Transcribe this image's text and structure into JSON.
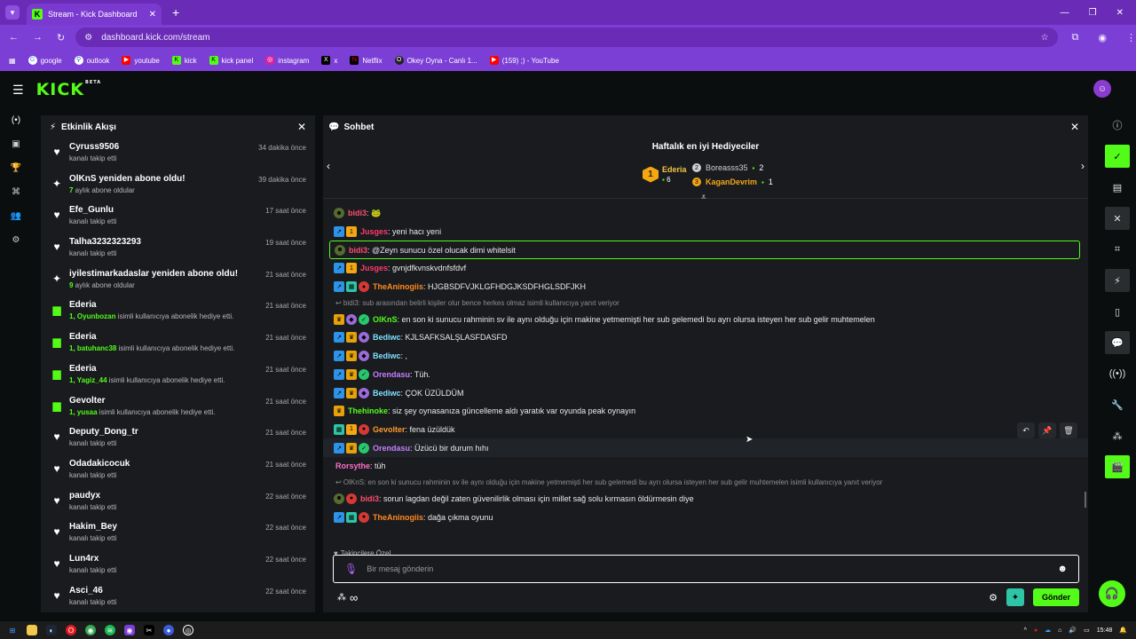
{
  "browser": {
    "tab_title": "Stream - Kick Dashboard",
    "url": "dashboard.kick.com/stream",
    "bookmarks": [
      "google",
      "outlook",
      "youtube",
      "kick",
      "kick panel",
      "instagram",
      "x",
      "Netflix",
      "Okey Oyna - Canlı 1...",
      "(159) ;) - YouTube"
    ]
  },
  "header": {
    "logo": "KICK",
    "beta": "BETA"
  },
  "activity": {
    "title": "Etkinlik Akışı",
    "events": [
      {
        "name": "Cyruss9506",
        "sub": "kanalı takip etti",
        "time": "34 dakika önce",
        "icon": "heart"
      },
      {
        "name": "OlKnS yeniden abone oldu!",
        "count": "7",
        "sub": " aylık abone oldular",
        "time": "39 dakika önce",
        "icon": "sparkle"
      },
      {
        "name": "Efe_Gunlu",
        "sub": "kanalı takip etti",
        "time": "17 saat önce",
        "icon": "heart"
      },
      {
        "name": "Talha3232323293",
        "sub": "kanalı takip etti",
        "time": "19 saat önce",
        "icon": "heart"
      },
      {
        "name": "iyilestimarkadaslar yeniden abone oldu!",
        "count": "9",
        "sub": " aylık abone oldular",
        "time": "21 saat önce",
        "icon": "sparkle"
      },
      {
        "name": "Ederia",
        "count": "1, Oyunbozan",
        "sub": " isimli kullanıcıya abonelik hediye etti.",
        "time": "21 saat önce",
        "icon": "gift"
      },
      {
        "name": "Ederia",
        "count": "1, batuhanc38",
        "sub": " isimli kullanıcıya abonelik hediye etti.",
        "time": "21 saat önce",
        "icon": "gift"
      },
      {
        "name": "Ederia",
        "count": "1, Yagiz_44",
        "sub": " isimli kullanıcıya abonelik hediye etti.",
        "time": "21 saat önce",
        "icon": "gift"
      },
      {
        "name": "Gevolter",
        "count": "1, yusaa",
        "sub": " isimli kullanıcıya abonelik hediye etti.",
        "time": "21 saat önce",
        "icon": "gift"
      },
      {
        "name": "Deputy_Dong_tr",
        "sub": "kanalı takip etti",
        "time": "21 saat önce",
        "icon": "heart"
      },
      {
        "name": "Odadakicocuk",
        "sub": "kanalı takip etti",
        "time": "21 saat önce",
        "icon": "heart"
      },
      {
        "name": "paudyx",
        "sub": "kanalı takip etti",
        "time": "22 saat önce",
        "icon": "heart"
      },
      {
        "name": "Hakim_Bey",
        "sub": "kanalı takip etti",
        "time": "22 saat önce",
        "icon": "heart"
      },
      {
        "name": "Lun4rx",
        "sub": "kanalı takip etti",
        "time": "22 saat önce",
        "icon": "heart"
      },
      {
        "name": "Asci_46",
        "sub": "kanalı takip etti",
        "time": "22 saat önce",
        "icon": "heart"
      }
    ]
  },
  "chat": {
    "title": "Sohbet",
    "gifters_title": "Haftalık en iyi Hediyeciler",
    "gifters": [
      {
        "rank": "1",
        "name": "Ederia",
        "count": "6",
        "color": "#f4c542"
      },
      {
        "rank": "2",
        "name": "Boreasss35",
        "count": "2",
        "color": "#cfcfcf"
      },
      {
        "rank": "3",
        "name": "KaganDevrim",
        "count": "1",
        "color": "#f2a713"
      }
    ],
    "messages": [
      {
        "type": "msg",
        "badges": [
          "bd"
        ],
        "user": "bidi3",
        "color": "#ff4d6d",
        "text": ": 🐸"
      },
      {
        "type": "msg",
        "badges": [
          "bv",
          "bo"
        ],
        "user": "Jusges",
        "color": "#ff3b6b",
        "text": ": yeni hacı yeni"
      },
      {
        "type": "msg",
        "badges": [
          "bd"
        ],
        "user": "bidi3",
        "color": "#ff4d6d",
        "text": ": @Zeyn sunucu özel olucak dimi whitelsit",
        "highlight": true
      },
      {
        "type": "msg",
        "badges": [
          "bv",
          "bo"
        ],
        "user": "Jusges",
        "color": "#ff3b6b",
        "text": ": gvnjdfkvnskvdnfsfdvf"
      },
      {
        "type": "msg",
        "badges": [
          "bv",
          "bf",
          "br"
        ],
        "user": "TheAninogiis",
        "color": "#ff8a1f",
        "text": ": HJGBSDFVJKLGFHDGJKSDFHGLSDFJKH"
      },
      {
        "type": "reply",
        "text": "↩ bidi3: sub arasından belirli kişiler olur bence herkes olmaz isimli kullanıcıya yanıt veriyor"
      },
      {
        "type": "msg",
        "badges": [
          "bc",
          "bu",
          "bg"
        ],
        "user": "OlKnS",
        "color": "#53fc18",
        "text": ": en son ki sunucu rahminin sv ile aynı olduğu için makine yetmemişti her sub gelemedi bu ayrı olursa isteyen her sub gelir muhtemelen"
      },
      {
        "type": "msg",
        "badges": [
          "bv",
          "bc",
          "bu"
        ],
        "user": "Bediwc",
        "color": "#7ee0ff",
        "text": ": KJLSAFKSALŞLASFDASFD"
      },
      {
        "type": "msg",
        "badges": [
          "bv",
          "bc",
          "bu"
        ],
        "user": "Bediwc",
        "color": "#7ee0ff",
        "text": ": ,"
      },
      {
        "type": "msg",
        "badges": [
          "bv",
          "bc",
          "bg"
        ],
        "user": "Orendasu",
        "color": "#c77dff",
        "text": ": Tüh."
      },
      {
        "type": "msg",
        "badges": [
          "bv",
          "bc",
          "bu"
        ],
        "user": "Bediwc",
        "color": "#7ee0ff",
        "text": ": ÇOK ÜZÜLDÜM"
      },
      {
        "type": "msg",
        "badges": [
          "bc"
        ],
        "user": "Thehinoke",
        "color": "#53fc18",
        "text": ": siz şey oynasanıza güncelleme aldı yaratık var oyunda peak oynayın"
      },
      {
        "type": "msg",
        "badges": [
          "bf",
          "bo",
          "br"
        ],
        "user": "Gevolter",
        "color": "#ff9a2e",
        "text": ": fena üzüldük"
      },
      {
        "type": "msg",
        "badges": [
          "bv",
          "bc",
          "bg"
        ],
        "user": "Orendasu",
        "color": "#c77dff",
        "text": ": Üzücü bir durum hıhı",
        "tools": true
      },
      {
        "type": "msg",
        "badges": [],
        "user": "Rorsythe",
        "color": "#ff6ec7",
        "text": ": tüh"
      },
      {
        "type": "reply",
        "text": "↩ OlKnS: en son ki sunucu rahminin sv ile aynı olduğu için makine yetmemişti her sub gelemedi bu ayrı olursa isteyen her sub gelir muhtemelen isimli kullanıcıya yanıt veriyor"
      },
      {
        "type": "msg",
        "badges": [
          "bd",
          "br"
        ],
        "user": "bidi3",
        "color": "#ff4d6d",
        "text": ": sorun lagdan değil zaten güvenilirlik olması için millet sağ solu kırmasın öldürmesin diye"
      },
      {
        "type": "msg",
        "badges": [
          "bv",
          "bf",
          "br"
        ],
        "user": "TheAninogiis",
        "color": "#ff8a1f",
        "text": ": dağa çıkma oyunu"
      }
    ],
    "followers_only": "Takipçilere Özel",
    "input_placeholder": "Bir mesaj gönderin",
    "send_label": "Gönder",
    "points_symbol": "∞"
  },
  "taskbar": {
    "time": "15:48"
  }
}
